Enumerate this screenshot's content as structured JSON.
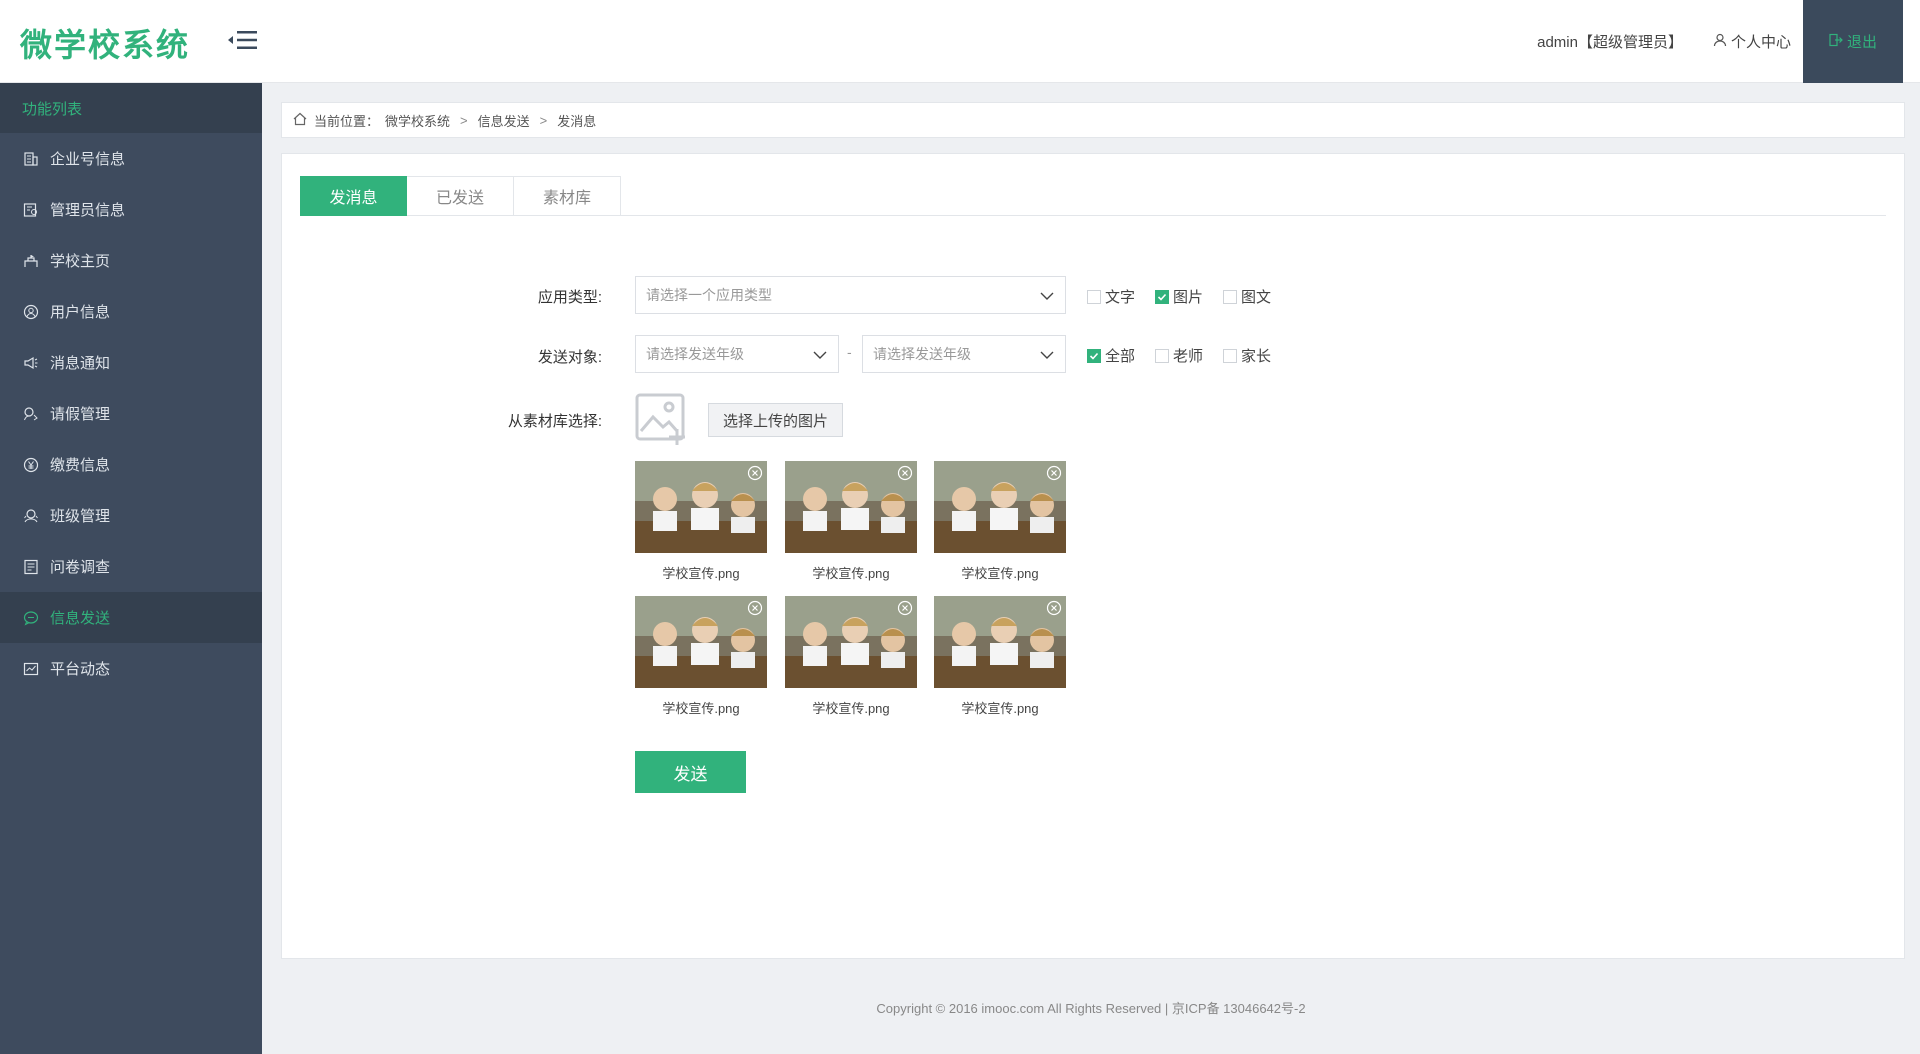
{
  "header": {
    "logo": "微学校系统",
    "admin_text": "admin【超级管理员】",
    "user_center": "个人中心",
    "logout": "退出"
  },
  "sidebar": {
    "title": "功能列表",
    "items": [
      {
        "label": "企业号信息",
        "icon": "building-icon"
      },
      {
        "label": "管理员信息",
        "icon": "admin-card-icon"
      },
      {
        "label": "学校主页",
        "icon": "school-icon"
      },
      {
        "label": "用户信息",
        "icon": "user-circle-icon"
      },
      {
        "label": "消息通知",
        "icon": "speaker-icon"
      },
      {
        "label": "请假管理",
        "icon": "leave-icon"
      },
      {
        "label": "缴费信息",
        "icon": "yen-icon"
      },
      {
        "label": "班级管理",
        "icon": "class-icon"
      },
      {
        "label": "问卷调查",
        "icon": "survey-icon"
      },
      {
        "label": "信息发送",
        "icon": "chat-icon"
      },
      {
        "label": "平台动态",
        "icon": "chart-icon"
      }
    ],
    "active_index": 9
  },
  "breadcrumb": {
    "prefix": "当前位置：",
    "items": [
      "微学校系统",
      "信息发送",
      "发消息"
    ],
    "separator": ">"
  },
  "tabs": [
    {
      "label": "发消息",
      "active": true
    },
    {
      "label": "已发送",
      "active": false
    },
    {
      "label": "素材库",
      "active": false
    }
  ],
  "form": {
    "app_type_label": "应用类型:",
    "app_type_placeholder": "请选择一个应用类型",
    "app_type_checks": [
      {
        "label": "文字",
        "checked": false
      },
      {
        "label": "图片",
        "checked": true
      },
      {
        "label": "图文",
        "checked": false
      }
    ],
    "target_label": "发送对象:",
    "target_placeholder_1": "请选择发送年级",
    "target_dash": "-",
    "target_placeholder_2": "请选择发送年级",
    "target_checks": [
      {
        "label": "全部",
        "checked": true
      },
      {
        "label": "老师",
        "checked": false
      },
      {
        "label": "家长",
        "checked": false
      }
    ],
    "library_label": "从素材库选择:",
    "upload_button": "选择上传的图片",
    "images": [
      {
        "name": "学校宣传.png"
      },
      {
        "name": "学校宣传.png"
      },
      {
        "name": "学校宣传.png"
      },
      {
        "name": "学校宣传.png"
      },
      {
        "name": "学校宣传.png"
      },
      {
        "name": "学校宣传.png"
      }
    ],
    "send_button": "发送"
  },
  "footer": "Copyright © 2016 imooc.com All Rights Reserved | 京ICP备 13046642号-2",
  "colors": {
    "accent": "#31b27c",
    "sidebar_bg": "#3e4b5e",
    "sidebar_dark": "#34404f"
  }
}
